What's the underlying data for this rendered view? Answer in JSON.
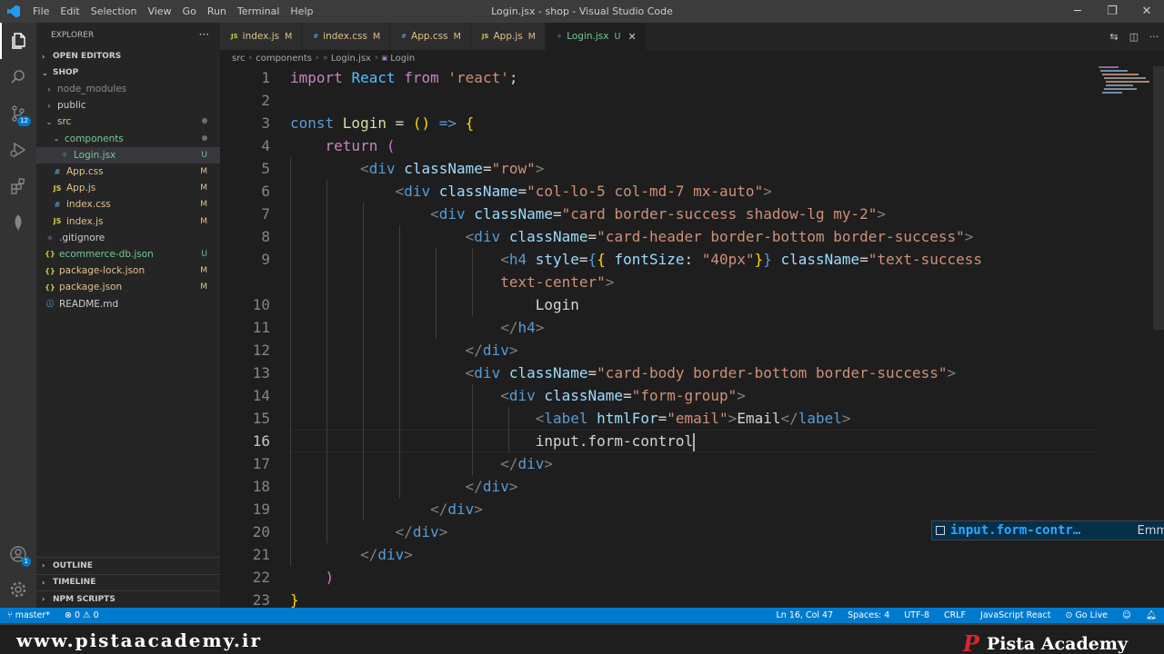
{
  "app": {
    "menu": [
      "File",
      "Edit",
      "Selection",
      "View",
      "Go",
      "Run",
      "Terminal",
      "Help"
    ],
    "window_title": "Login.jsx - shop - Visual Studio Code"
  },
  "activity": {
    "scm_badge": "12",
    "accounts_badge": "1"
  },
  "sidebar": {
    "title": "EXPLORER",
    "open_editors": "OPEN EDITORS",
    "root": "SHOP",
    "tree": [
      {
        "label": "node_modules",
        "indent": 1,
        "chev": "›",
        "icon": "",
        "status": "",
        "cls": "dim"
      },
      {
        "label": "public",
        "indent": 1,
        "chev": "›",
        "icon": "",
        "status": "",
        "cls": ""
      },
      {
        "label": "src",
        "indent": 1,
        "chev": "⌄",
        "icon": "",
        "status": "dot",
        "cls": "mod"
      },
      {
        "label": "components",
        "indent": 2,
        "chev": "⌄",
        "icon": "",
        "status": "dot",
        "cls": "unt"
      },
      {
        "label": "Login.jsx",
        "indent": 3,
        "chev": "",
        "icon": "react",
        "status": "U",
        "cls": "unt",
        "selected": true
      },
      {
        "label": "App.css",
        "indent": 2,
        "chev": "",
        "icon": "css",
        "status": "M",
        "cls": "mod"
      },
      {
        "label": "App.js",
        "indent": 2,
        "chev": "",
        "icon": "js",
        "status": "M",
        "cls": "mod"
      },
      {
        "label": "index.css",
        "indent": 2,
        "chev": "",
        "icon": "css",
        "status": "M",
        "cls": "mod"
      },
      {
        "label": "index.js",
        "indent": 2,
        "chev": "",
        "icon": "js",
        "status": "M",
        "cls": "mod"
      },
      {
        "label": ".gitignore",
        "indent": 1,
        "chev": "",
        "icon": "git",
        "status": "",
        "cls": ""
      },
      {
        "label": "ecommerce-db.json",
        "indent": 1,
        "chev": "",
        "icon": "json",
        "status": "U",
        "cls": "unt"
      },
      {
        "label": "package-lock.json",
        "indent": 1,
        "chev": "",
        "icon": "json",
        "status": "M",
        "cls": "mod"
      },
      {
        "label": "package.json",
        "indent": 1,
        "chev": "",
        "icon": "json",
        "status": "M",
        "cls": "mod"
      },
      {
        "label": "README.md",
        "indent": 1,
        "chev": "",
        "icon": "info",
        "status": "",
        "cls": ""
      }
    ],
    "outline": "OUTLINE",
    "timeline": "TIMELINE",
    "npm": "NPM SCRIPTS"
  },
  "tabs": [
    {
      "label": "index.js",
      "status": "M",
      "icon": "js",
      "active": false
    },
    {
      "label": "index.css",
      "status": "M",
      "icon": "css",
      "active": false
    },
    {
      "label": "App.css",
      "status": "M",
      "icon": "css",
      "active": false
    },
    {
      "label": "App.js",
      "status": "M",
      "icon": "js",
      "active": false
    },
    {
      "label": "Login.jsx",
      "status": "U",
      "icon": "react",
      "active": true
    }
  ],
  "breadcrumb": [
    "src",
    "components",
    "Login.jsx",
    "Login"
  ],
  "editor": {
    "lines": [
      {
        "n": "1",
        "t": [
          [
            "kw",
            "import "
          ],
          [
            "vr",
            "React "
          ],
          [
            "kw",
            "from "
          ],
          [
            "sv",
            "'react'"
          ],
          [
            "tx",
            ";"
          ]
        ]
      },
      {
        "n": "2",
        "t": []
      },
      {
        "n": "3",
        "t": [
          [
            "st",
            "const "
          ],
          [
            "fn",
            "Login "
          ],
          [
            "tx",
            "= "
          ],
          [
            "yb",
            "() "
          ],
          [
            "st",
            "=> "
          ],
          [
            "yb",
            "{"
          ]
        ]
      },
      {
        "n": "4",
        "t": [
          [
            "tx",
            "    "
          ],
          [
            "kw",
            "return "
          ],
          [
            "pb",
            "("
          ]
        ]
      },
      {
        "n": "5",
        "t": [
          [
            "tx",
            "        "
          ],
          [
            "br",
            "<"
          ],
          [
            "tg",
            "div "
          ],
          [
            "at",
            "className"
          ],
          [
            "tx",
            "="
          ],
          [
            "sv",
            "\"row\""
          ],
          [
            "br",
            ">"
          ]
        ]
      },
      {
        "n": "6",
        "t": [
          [
            "tx",
            "            "
          ],
          [
            "br",
            "<"
          ],
          [
            "tg",
            "div "
          ],
          [
            "at",
            "className"
          ],
          [
            "tx",
            "="
          ],
          [
            "sv",
            "\"col-lo-5 col-md-7 mx-auto\""
          ],
          [
            "br",
            ">"
          ]
        ]
      },
      {
        "n": "7",
        "t": [
          [
            "tx",
            "                "
          ],
          [
            "br",
            "<"
          ],
          [
            "tg",
            "div "
          ],
          [
            "at",
            "className"
          ],
          [
            "tx",
            "="
          ],
          [
            "sv",
            "\"card border-success shadow-lg my-2\""
          ],
          [
            "br",
            ">"
          ]
        ]
      },
      {
        "n": "8",
        "t": [
          [
            "tx",
            "                    "
          ],
          [
            "br",
            "<"
          ],
          [
            "tg",
            "div "
          ],
          [
            "at",
            "className"
          ],
          [
            "tx",
            "="
          ],
          [
            "sv",
            "\"card-header border-bottom border-success\""
          ],
          [
            "br",
            ">"
          ]
        ]
      },
      {
        "n": "9",
        "t": [
          [
            "tx",
            "                        "
          ],
          [
            "br",
            "<"
          ],
          [
            "tg",
            "h4 "
          ],
          [
            "at",
            "style"
          ],
          [
            "tx",
            "="
          ],
          [
            "st",
            "{"
          ],
          [
            "yb",
            "{ "
          ],
          [
            "at",
            "fontSize"
          ],
          [
            "tx",
            ": "
          ],
          [
            "sv",
            "\"40px\""
          ],
          [
            "yb",
            "}"
          ],
          [
            "st",
            "} "
          ],
          [
            "at",
            "className"
          ],
          [
            "tx",
            "="
          ],
          [
            "sv",
            "\"text-success"
          ]
        ]
      },
      {
        "n": "",
        "t": [
          [
            "tx",
            "                        "
          ],
          [
            "sv",
            "text-center\""
          ],
          [
            "br",
            ">"
          ]
        ]
      },
      {
        "n": "10",
        "t": [
          [
            "tx",
            "                            Login"
          ]
        ]
      },
      {
        "n": "11",
        "t": [
          [
            "tx",
            "                        "
          ],
          [
            "br",
            "</"
          ],
          [
            "tg",
            "h4"
          ],
          [
            "br",
            ">"
          ]
        ]
      },
      {
        "n": "12",
        "t": [
          [
            "tx",
            "                    "
          ],
          [
            "br",
            "</"
          ],
          [
            "tg",
            "div"
          ],
          [
            "br",
            ">"
          ]
        ]
      },
      {
        "n": "13",
        "t": [
          [
            "tx",
            "                    "
          ],
          [
            "br",
            "<"
          ],
          [
            "tg",
            "div "
          ],
          [
            "at",
            "className"
          ],
          [
            "tx",
            "="
          ],
          [
            "sv",
            "\"card-body border-bottom border-success\""
          ],
          [
            "br",
            ">"
          ]
        ]
      },
      {
        "n": "14",
        "t": [
          [
            "tx",
            "                        "
          ],
          [
            "br",
            "<"
          ],
          [
            "tg",
            "div "
          ],
          [
            "at",
            "className"
          ],
          [
            "tx",
            "="
          ],
          [
            "sv",
            "\"form-group\""
          ],
          [
            "br",
            ">"
          ]
        ]
      },
      {
        "n": "15",
        "t": [
          [
            "tx",
            "                            "
          ],
          [
            "br",
            "<"
          ],
          [
            "tg",
            "label "
          ],
          [
            "at",
            "htmlFor"
          ],
          [
            "tx",
            "="
          ],
          [
            "sv",
            "\"email\""
          ],
          [
            "br",
            ">"
          ],
          [
            "tx",
            "Email"
          ],
          [
            "br",
            "</"
          ],
          [
            "tg",
            "label"
          ],
          [
            "br",
            ">"
          ]
        ]
      },
      {
        "n": "16",
        "t": [
          [
            "tx",
            "                            input.form-control"
          ]
        ],
        "cursor": true
      },
      {
        "n": "17",
        "t": [
          [
            "tx",
            "                        "
          ],
          [
            "br",
            "</"
          ],
          [
            "tg",
            "div"
          ],
          [
            "br",
            ">"
          ]
        ]
      },
      {
        "n": "18",
        "t": [
          [
            "tx",
            "                    "
          ],
          [
            "br",
            "</"
          ],
          [
            "tg",
            "div"
          ],
          [
            "br",
            ">"
          ]
        ]
      },
      {
        "n": "19",
        "t": [
          [
            "tx",
            "                "
          ],
          [
            "br",
            "</"
          ],
          [
            "tg",
            "div"
          ],
          [
            "br",
            ">"
          ]
        ]
      },
      {
        "n": "20",
        "t": [
          [
            "tx",
            "            "
          ],
          [
            "br",
            "</"
          ],
          [
            "tg",
            "div"
          ],
          [
            "br",
            ">"
          ]
        ]
      },
      {
        "n": "21",
        "t": [
          [
            "tx",
            "        "
          ],
          [
            "br",
            "</"
          ],
          [
            "tg",
            "div"
          ],
          [
            "br",
            ">"
          ]
        ]
      },
      {
        "n": "22",
        "t": [
          [
            "tx",
            "    "
          ],
          [
            "pb",
            ")"
          ]
        ]
      },
      {
        "n": "23",
        "t": [
          [
            "yb",
            "}"
          ]
        ]
      }
    ],
    "current_line": "16",
    "suggestion": {
      "label": "input.form-contr…",
      "detail": "Emmet Abbrevia…"
    }
  },
  "statusbar": {
    "branch": "master*",
    "errors": "⊗ 0 ⚠ 0",
    "position": "Ln 16, Col 47",
    "spaces": "Spaces: 4",
    "encoding": "UTF-8",
    "eol": "CRLF",
    "language": "JavaScript React",
    "golive": "Go Live"
  },
  "watermark": {
    "url": "www.pistaacademy.ir",
    "brand": "Pista Academy",
    "logo_letter": "P"
  },
  "colors": {
    "accent": "#007acc",
    "modified": "#e2c08d",
    "untracked": "#73c991"
  }
}
